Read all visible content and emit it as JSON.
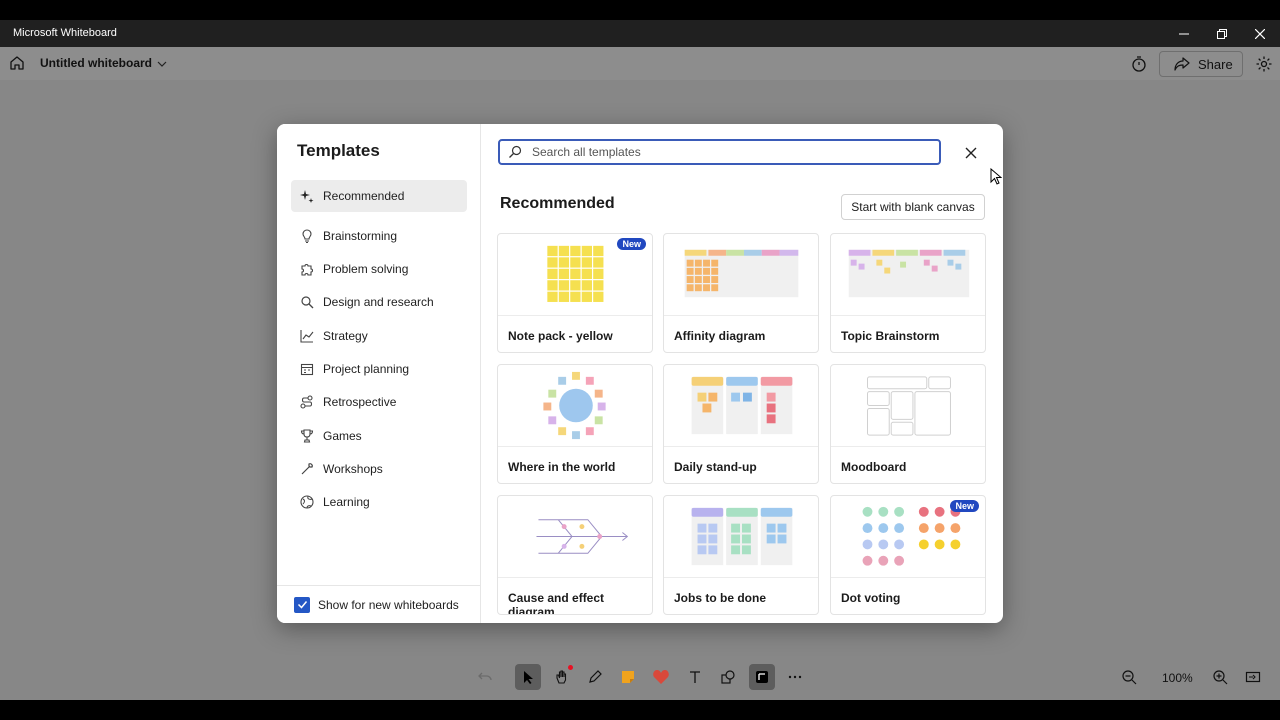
{
  "window": {
    "title": "Microsoft Whiteboard"
  },
  "appbar": {
    "board_title": "Untitled whiteboard",
    "share_label": "Share"
  },
  "dialog": {
    "heading": "Templates",
    "categories": [
      {
        "label": "Recommended",
        "icon": "sparkle-icon",
        "selected": true
      },
      {
        "label": "Brainstorming",
        "icon": "lightbulb-icon"
      },
      {
        "label": "Problem solving",
        "icon": "puzzle-icon"
      },
      {
        "label": "Design and research",
        "icon": "search-icon"
      },
      {
        "label": "Strategy",
        "icon": "chart-line-icon"
      },
      {
        "label": "Project planning",
        "icon": "calendar-icon"
      },
      {
        "label": "Retrospective",
        "icon": "flow-icon"
      },
      {
        "label": "Games",
        "icon": "trophy-icon"
      },
      {
        "label": "Workshops",
        "icon": "tools-icon"
      },
      {
        "label": "Learning",
        "icon": "globe-icon"
      }
    ],
    "show_for_new_label": "Show for new whiteboards",
    "show_for_new_checked": true,
    "search_placeholder": "Search all templates",
    "section_title": "Recommended",
    "blank_canvas_label": "Start with blank canvas",
    "new_badge": "New",
    "templates": [
      {
        "label": "Note pack - yellow",
        "is_new": true
      },
      {
        "label": "Affinity diagram"
      },
      {
        "label": "Topic Brainstorm"
      },
      {
        "label": "Where in the world"
      },
      {
        "label": "Daily stand-up"
      },
      {
        "label": "Moodboard"
      },
      {
        "label": "Cause and effect diagram"
      },
      {
        "label": "Jobs to be done"
      },
      {
        "label": "Dot voting",
        "is_new": true
      }
    ]
  },
  "zoom": {
    "level": "100%"
  },
  "colors": {
    "accent": "#2148c0",
    "canvas": "#878787",
    "titlebar": "#202020"
  }
}
